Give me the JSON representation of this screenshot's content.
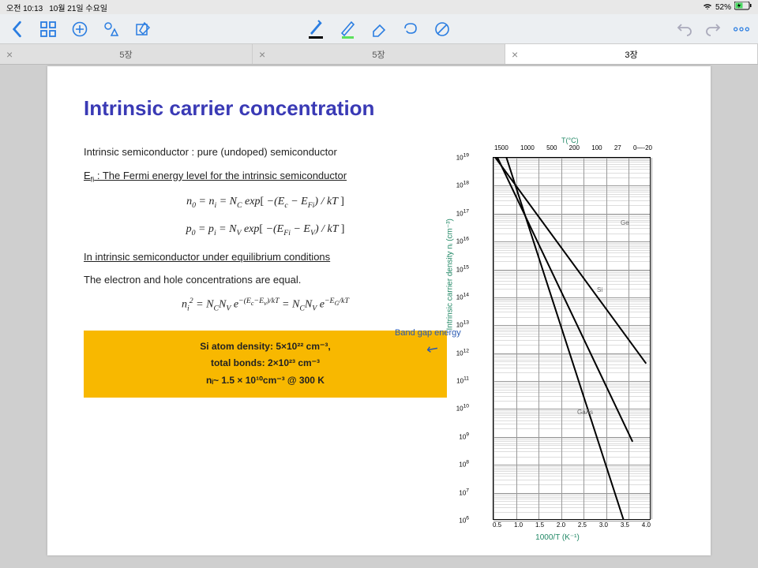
{
  "status": {
    "time": "오전 10:13",
    "date": "10월 21일 수요일",
    "battery": "52%"
  },
  "tabs": [
    {
      "label": "5장"
    },
    {
      "label": "5장"
    },
    {
      "label": "3장"
    }
  ],
  "doc": {
    "title": "Intrinsic carrier concentration",
    "l1": "Intrinsic semiconductor : pure (undoped) semiconductor",
    "l2": "E_fi : The Fermi energy level for the intrinsic semiconductor",
    "eq1": "n₀ = nᵢ = N_C exp[ −(E_c − E_Fi) / kT ]",
    "eq2": "p₀ = pᵢ = N_V exp[ −(E_Fi − E_V) / kT ]",
    "l3": "In intrinsic semiconductor under equilibrium conditions",
    "l4": "The electron and hole concentrations are equal.",
    "note": "Band gap energy",
    "eq3": "nᵢ² = N_C N_V e^{−(E_c−E_v)/kT} = N_C N_V e^{−E_G/kT}",
    "box1": "Si atom density: 5×10²² cm⁻³,",
    "box2": "total bonds: 2×10²³ cm⁻³",
    "box3": "nᵢ~ 1.5 × 10¹⁰cm⁻³ @ 300 K"
  },
  "chart_data": {
    "type": "line",
    "title": "",
    "xlabel": "1000/T (K⁻¹)",
    "ylabel": "Intrinsic carrier density nᵢ (cm⁻³)",
    "top_axis_label": "T(°C)",
    "top_ticks": [
      "1500",
      "1000",
      "500",
      "200",
      "100",
      "27",
      "0—-20"
    ],
    "x_ticks": [
      "0.5",
      "1.0",
      "1.5",
      "2.0",
      "2.5",
      "3.0",
      "3.5",
      "4.0"
    ],
    "y_exponents": [
      19,
      18,
      17,
      16,
      15,
      14,
      13,
      12,
      11,
      10,
      9,
      8,
      7,
      6
    ],
    "xlim": [
      0.5,
      4.0
    ],
    "ylim_log10": [
      6,
      19
    ],
    "series": [
      {
        "name": "Ge",
        "points": [
          [
            0.55,
            19
          ],
          [
            3.9,
            11.6
          ]
        ]
      },
      {
        "name": "Si",
        "points": [
          [
            0.6,
            19
          ],
          [
            3.6,
            8.8
          ]
        ]
      },
      {
        "name": "GaAs",
        "points": [
          [
            0.8,
            19
          ],
          [
            3.4,
            6
          ]
        ]
      }
    ]
  }
}
